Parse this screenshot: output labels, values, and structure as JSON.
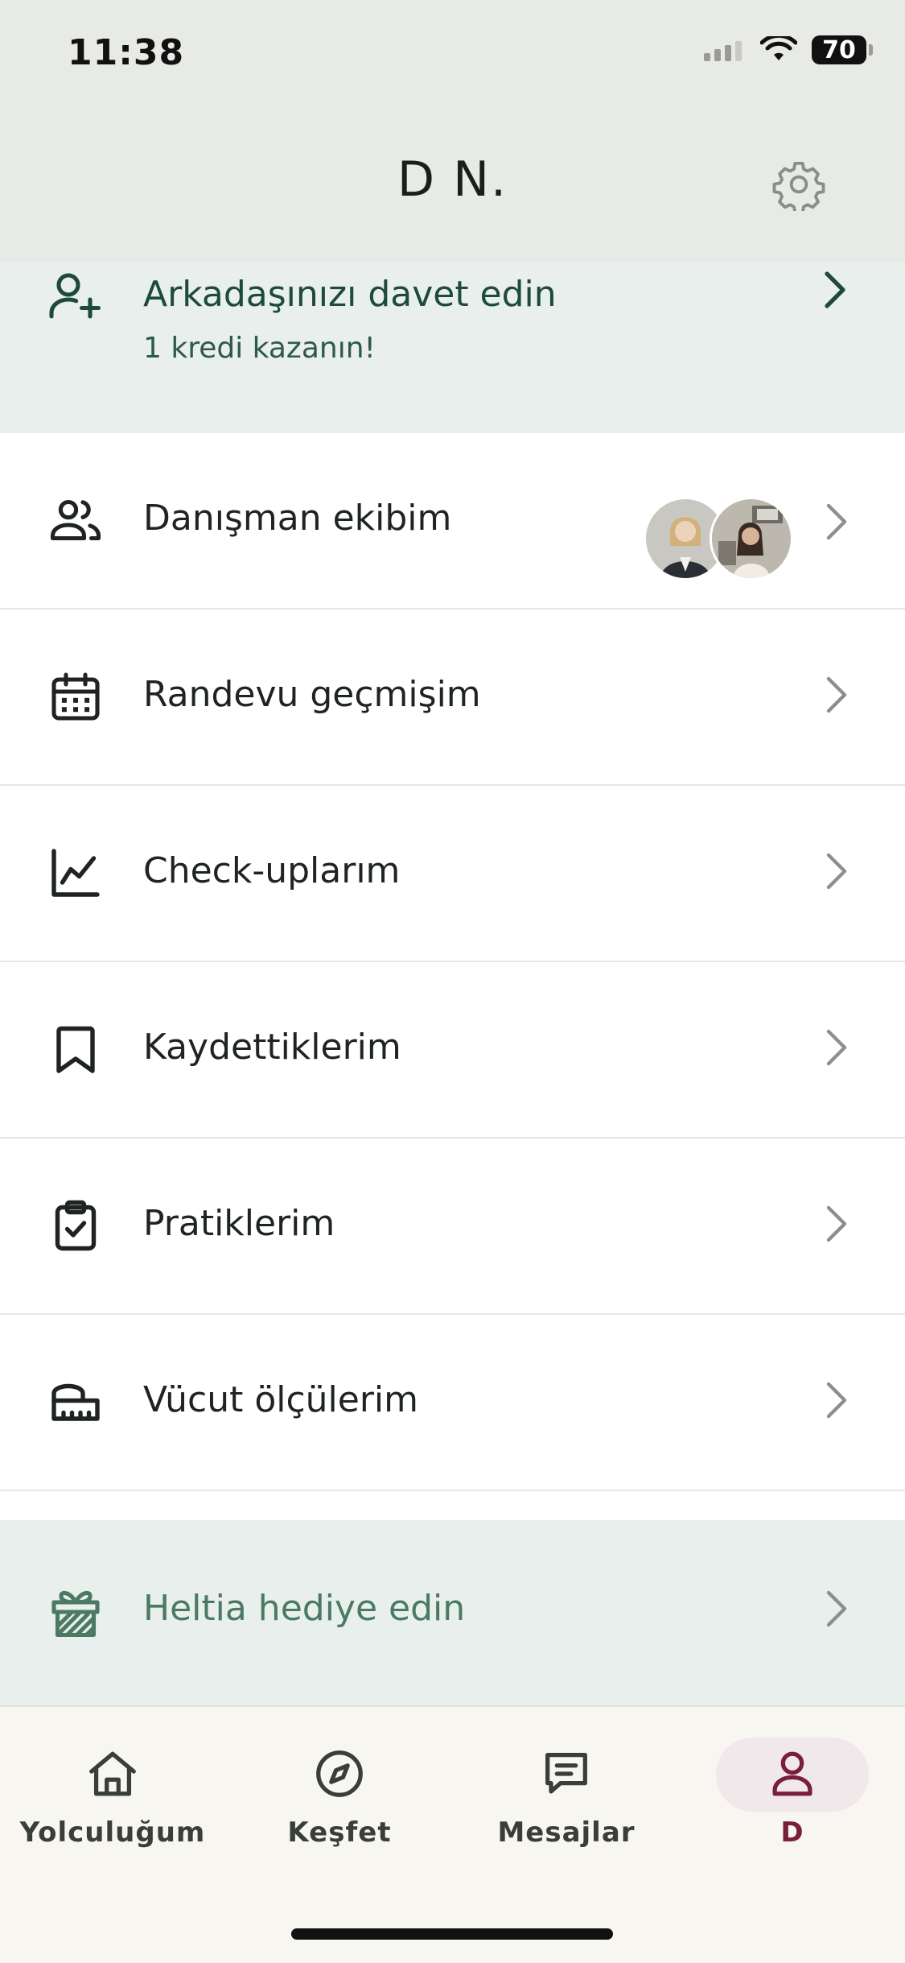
{
  "status_bar": {
    "time": "11:38",
    "battery": "70"
  },
  "header": {
    "title": "D N."
  },
  "invite": {
    "title": "Arkadaşınızı davet edin",
    "subtitle": "1 kredi kazanın!"
  },
  "menu": {
    "advisors": "Danışman ekibim",
    "appointments": "Randevu geçmişim",
    "checkups": "Check-uplarım",
    "saved": "Kaydettiklerim",
    "practices": "Pratiklerim",
    "measurements": "Vücut ölçülerim",
    "gift": "Heltia hediye edin"
  },
  "tabs": {
    "journey": "Yolculuğum",
    "discover": "Keşfet",
    "messages": "Mesajlar",
    "profile": "D"
  },
  "colors": {
    "accent_green": "#1e4a3a",
    "active_tab": "#7a1f3b",
    "header_bg": "#e8eae6",
    "highlight_bg": "#e8efec"
  }
}
